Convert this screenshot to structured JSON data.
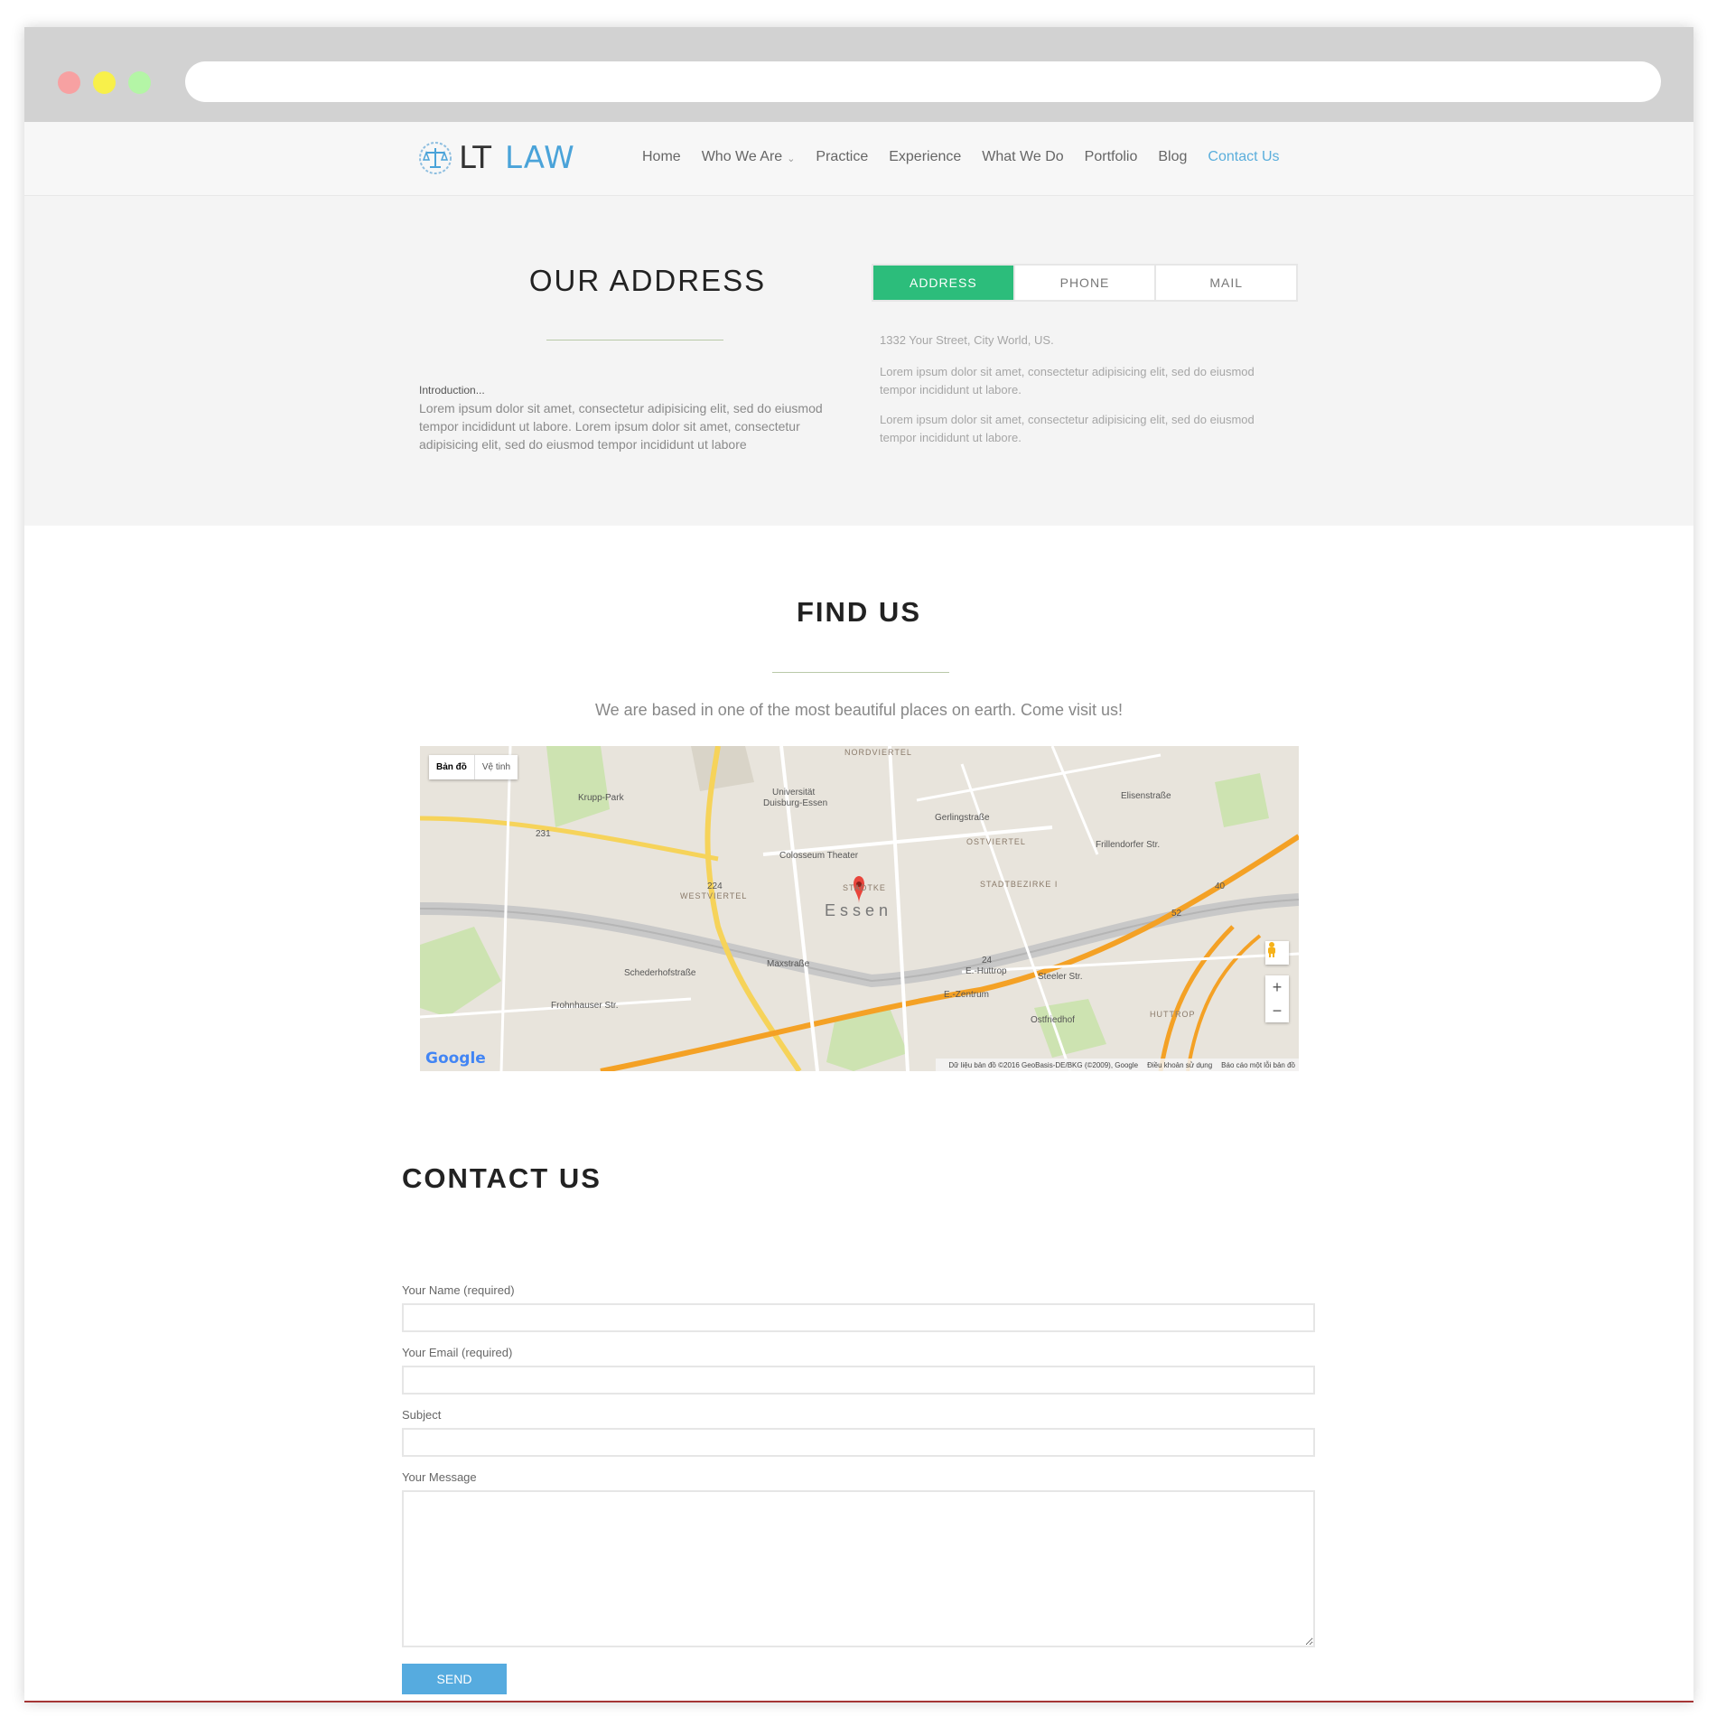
{
  "window": {
    "address_bar": ""
  },
  "brand": {
    "logo_lt": "LT",
    "logo_law": "LAW",
    "accent_color": "#4aa3d9"
  },
  "nav": {
    "items": [
      {
        "label": "Home"
      },
      {
        "label": "Who We Are"
      },
      {
        "label": "Practice"
      },
      {
        "label": "Experience"
      },
      {
        "label": "What We Do"
      },
      {
        "label": "Portfolio"
      },
      {
        "label": "Blog"
      },
      {
        "label": "Contact Us"
      }
    ],
    "active": "Contact Us",
    "dropdown_icon": "chevron-down-icon"
  },
  "address_section": {
    "title": "OUR ADDRESS",
    "intro_label": "Introduction...",
    "intro_text": "Lorem ipsum dolor sit amet, consectetur adipisicing elit, sed do eiusmod tempor incididunt ut labore. Lorem ipsum dolor sit amet, consectetur adipisicing elit, sed do eiusmod tempor incididunt ut labore",
    "tabs": [
      {
        "label": "ADDRESS"
      },
      {
        "label": "PHONE"
      },
      {
        "label": "MAIL"
      }
    ],
    "active_tab": "ADDRESS",
    "active_tab_color": "#2cbd7b",
    "address_line": "1332 Your Street, City World, US.",
    "paragraphs": [
      "Lorem ipsum dolor sit amet, consectetur adipisicing elit, sed do eiusmod tempor incididunt ut labore.",
      "Lorem ipsum dolor sit amet, consectetur adipisicing elit, sed do eiusmod tempor incididunt ut labore."
    ]
  },
  "find_section": {
    "title": "FIND US",
    "subtitle": "We are based in one of the most beautiful places on earth. Come visit us!"
  },
  "map": {
    "type_toggle": [
      "Bản đồ",
      "Vệ tinh"
    ],
    "selected_type": "Bản đồ",
    "city_label": "Essen",
    "labels": {
      "krupp_park": "Krupp-Park",
      "university": "Universität",
      "university2": "Duisburg-Essen",
      "theater": "Colosseum Theater",
      "nordviertel": "NORDVIERTEL",
      "ostviertel": "OSTVIERTEL",
      "westviertel": "WESTVIERTEL",
      "stadtkern": "STADTKE",
      "stadtbezirke": "STADTBEZIRKE I",
      "huttrop": "HUTTROP",
      "ostfriedhof": "Ostfriedhof",
      "gerlingstrasse": "Gerlingstraße",
      "elisenstrasse": "Elisenstraße",
      "frillendorfer": "Frillendorfer Str.",
      "maxstrasse": "Maxstraße",
      "steeler": "Steeler Str.",
      "schederhofstrasse": "Schederhofstraße",
      "frohnhauser": "Frohnhauser Str.",
      "huttrop_exit": "E.-Huttrop",
      "zentrum_exit": "E.-Zentrum",
      "route_231": "231",
      "route_224": "224",
      "route_40": "40",
      "route_52": "52",
      "route_24": "24"
    },
    "zoom_in": "+",
    "zoom_out": "−",
    "logo_text": "Google",
    "footer": [
      "Dữ liệu bản đồ ©2016 GeoBasis-DE/BKG (©2009), Google",
      "Điều khoản sử dụng",
      "Báo cáo một lỗi bản đồ"
    ],
    "marker_color": "#e8453c",
    "highway_color": "#f4a125",
    "major_road_color": "#f6d35a"
  },
  "contact_section": {
    "title": "CONTACT US",
    "fields": {
      "name_label": "Your Name (required)",
      "email_label": "Your Email (required)",
      "subject_label": "Subject",
      "message_label": "Your Message",
      "name_value": "",
      "email_value": "",
      "subject_value": "",
      "message_value": ""
    },
    "send_label": "SEND",
    "send_color": "#56abdf"
  }
}
